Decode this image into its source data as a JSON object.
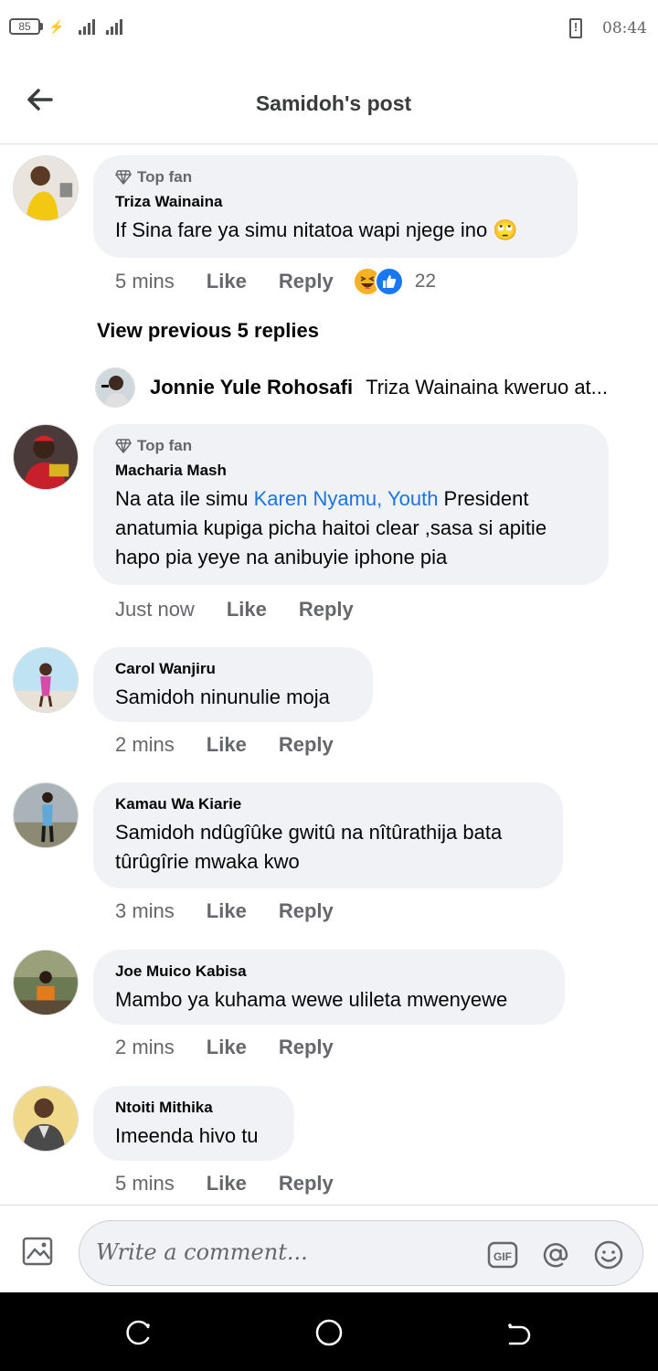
{
  "status_bar": {
    "battery": "85",
    "time": "08:44"
  },
  "header": {
    "title": "Samidoh's post"
  },
  "comments": [
    {
      "badge": "Top fan",
      "author": "Triza Wainaina",
      "text": "If Sina fare ya simu nitatoa wapi njege ino 🙄",
      "time": "5 mins",
      "like": "Like",
      "reply": "Reply",
      "reaction_count": "22"
    },
    {
      "badge": "Top fan",
      "author": "Macharia Mash",
      "text_before": "Na ata ile simu ",
      "mention": "Karen Nyamu, Youth",
      "text_after": " President anatumia kupiga picha haitoi clear ,sasa si apitie hapo pia yeye na anibuyie iphone pia",
      "time": "Just now",
      "like": "Like",
      "reply": "Reply"
    },
    {
      "author": "Carol Wanjiru",
      "text": "Samidoh ninunulie moja",
      "time": "2 mins",
      "like": "Like",
      "reply": "Reply"
    },
    {
      "author": "Kamau Wa Kiarie",
      "text": "Samidoh ndûgîûke gwitû na nîtûrathija bata tûrûgîrie mwaka kwo",
      "time": "3 mins",
      "like": "Like",
      "reply": "Reply"
    },
    {
      "author": "Joe Muico Kabisa",
      "text": "Mambo ya kuhama wewe ulileta mwenyewe",
      "time": "2 mins",
      "like": "Like",
      "reply": "Reply"
    },
    {
      "author": "Ntoiti Mithika",
      "text": "Imeenda hivo tu",
      "time": "5 mins",
      "like": "Like",
      "reply": "Reply"
    }
  ],
  "replies_thread": {
    "view_previous": "View previous 5 replies",
    "latest_reply_author": "Jonnie Yule Rohosafi",
    "latest_reply_text": "Triza Wainaina kweruo at..."
  },
  "composer": {
    "placeholder": "Write a comment..."
  },
  "colors": {
    "bubble": "#f0f2f5",
    "mention": "#1b74e4",
    "meta_text": "#65676b"
  }
}
